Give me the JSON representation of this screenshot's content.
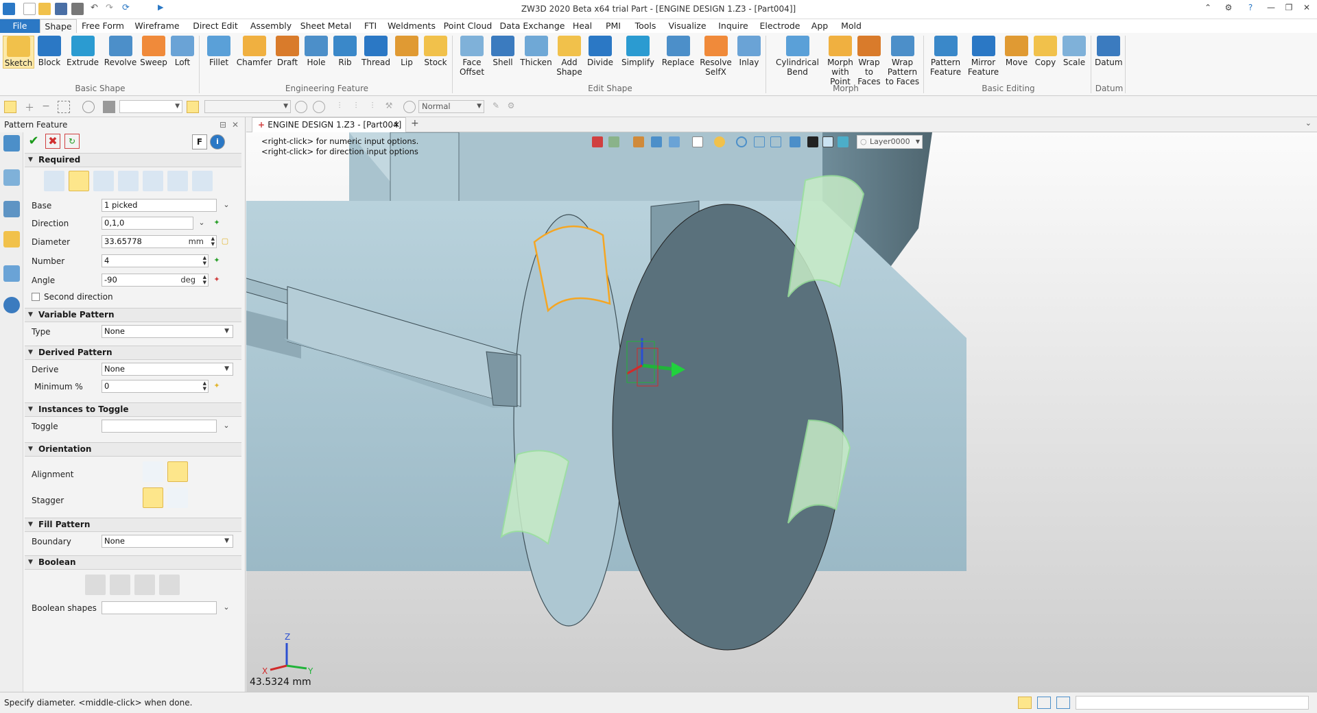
{
  "app": {
    "title": "ZW3D 2020 Beta x64 trial",
    "doc_title": "Part - [ENGINE DESIGN 1.Z3 - [Part004]]"
  },
  "menu": [
    "File",
    "Shape",
    "Free Form",
    "Wireframe",
    "Direct Edit",
    "Assembly",
    "Sheet Metal",
    "FTI",
    "Weldments",
    "Point Cloud",
    "Data Exchange",
    "Heal",
    "PMI",
    "Tools",
    "Visualize",
    "Inquire",
    "Electrode",
    "App",
    "Mold"
  ],
  "ribbon": {
    "groups": [
      {
        "label": "Basic Shape",
        "buttons": [
          "Sketch",
          "Block",
          "Extrude",
          "Revolve",
          "Sweep",
          "Loft"
        ]
      },
      {
        "label": "Engineering Feature",
        "buttons": [
          "Fillet",
          "Chamfer",
          "Draft",
          "Hole",
          "Rib",
          "Thread",
          "Lip",
          "Stock"
        ]
      },
      {
        "label": "Edit Shape",
        "buttons": [
          "Face Offset",
          "Shell",
          "Thicken",
          "Add Shape",
          "Divide",
          "Simplify",
          "Replace",
          "Resolve SelfX",
          "Inlay"
        ]
      },
      {
        "label": "Morph",
        "buttons": [
          "Cylindrical Bend",
          "Morph with Point",
          "Wrap to Faces",
          "Wrap Pattern to Faces"
        ]
      },
      {
        "label": "Basic Editing",
        "buttons": [
          "Pattern Feature",
          "Mirror Feature",
          "Move",
          "Copy",
          "Scale"
        ]
      },
      {
        "label": "Datum",
        "buttons": [
          "Datum"
        ]
      }
    ]
  },
  "toolbar2": {
    "filter_value": "",
    "style_value": "Normal"
  },
  "panel": {
    "title": "Pattern Feature",
    "f_label": "F",
    "sections": {
      "required": "Required",
      "variable": "Variable Pattern",
      "derived": "Derived Pattern",
      "toggle": "Instances to Toggle",
      "orientation": "Orientation",
      "fill": "Fill Pattern",
      "boolean": "Boolean"
    },
    "fields": {
      "base": {
        "label": "Base",
        "value": "1 picked"
      },
      "direction": {
        "label": "Direction",
        "value": "0,1,0"
      },
      "diameter": {
        "label": "Diameter",
        "value": "33.65778",
        "unit": "mm"
      },
      "number": {
        "label": "Number",
        "value": "4"
      },
      "angle": {
        "label": "Angle",
        "value": "-90",
        "unit": "deg"
      },
      "second_direction": {
        "label": "Second direction"
      },
      "type": {
        "label": "Type",
        "value": "None"
      },
      "derive": {
        "label": "Derive",
        "value": "None"
      },
      "minimum": {
        "label": "Minimum %",
        "value": "0"
      },
      "toggle": {
        "label": "Toggle",
        "value": ""
      },
      "alignment": {
        "label": "Alignment"
      },
      "stagger": {
        "label": "Stagger"
      },
      "boundary": {
        "label": "Boundary",
        "value": "None"
      },
      "boolean_shapes": {
        "label": "Boolean shapes",
        "value": ""
      }
    }
  },
  "doc_tab": {
    "label": "ENGINE DESIGN 1.Z3 - [Part004]"
  },
  "viewport": {
    "hint1": "<right-click> for numeric input options.",
    "hint2": "<right-click> for direction input options",
    "layer": "Layer0000",
    "measure": "43.5324 mm",
    "triad": {
      "x": "X",
      "y": "Y",
      "z": "Z"
    }
  },
  "status": {
    "message": "Specify diameter. <middle-click> when done."
  },
  "colors": {
    "accent": "#2b78c5",
    "highlight": "#fde68b",
    "preview": "#9be39b",
    "selected_edge": "#f5a623",
    "body": "#a7c3cf"
  }
}
